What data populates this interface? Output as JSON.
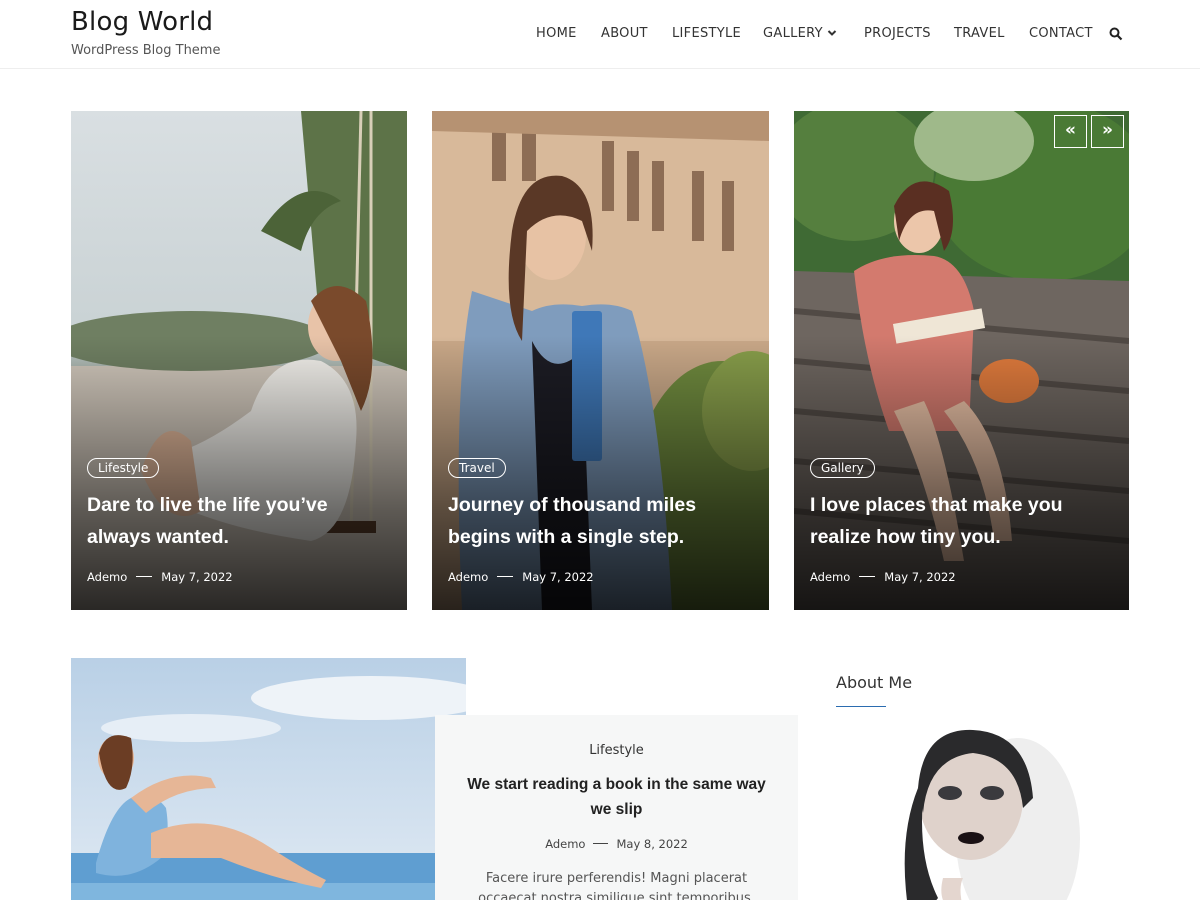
{
  "site": {
    "title": "Blog World",
    "tagline": "WordPress Blog Theme"
  },
  "nav": {
    "items": [
      {
        "label": "HOME"
      },
      {
        "label": "ABOUT"
      },
      {
        "label": "LIFESTYLE"
      },
      {
        "label": "GALLERY",
        "has_dropdown": true
      },
      {
        "label": "PROJECTS"
      },
      {
        "label": "TRAVEL"
      },
      {
        "label": "CONTACT"
      }
    ],
    "search_icon": "search-icon"
  },
  "slider": {
    "prev_label": "«",
    "next_label": "»",
    "cards": [
      {
        "category": "Lifestyle",
        "title": "Dare to live the life you’ve always wanted.",
        "author": "Ademo",
        "date": "May 7, 2022"
      },
      {
        "category": "Travel",
        "title": "Journey of thousand miles begins with a single step.",
        "author": "Ademo",
        "date": "May 7, 2022"
      },
      {
        "category": "Gallery",
        "title": "I love places that make you realize how tiny you.",
        "author": "Ademo",
        "date": "May 7, 2022"
      }
    ]
  },
  "featured": {
    "category": "Lifestyle",
    "title": "We start reading a book in the same way we slip",
    "author": "Ademo",
    "date": "May 8, 2022",
    "excerpt": "Facere irure perferendis! Magni placerat occaecat nostra similique sint temporibus. Deleniti eius sequi"
  },
  "sidebar": {
    "about_title": "About Me"
  },
  "colors": {
    "accent": "#2b6cb0",
    "text_dark": "#222222",
    "panel_bg": "#f6f7f7"
  }
}
